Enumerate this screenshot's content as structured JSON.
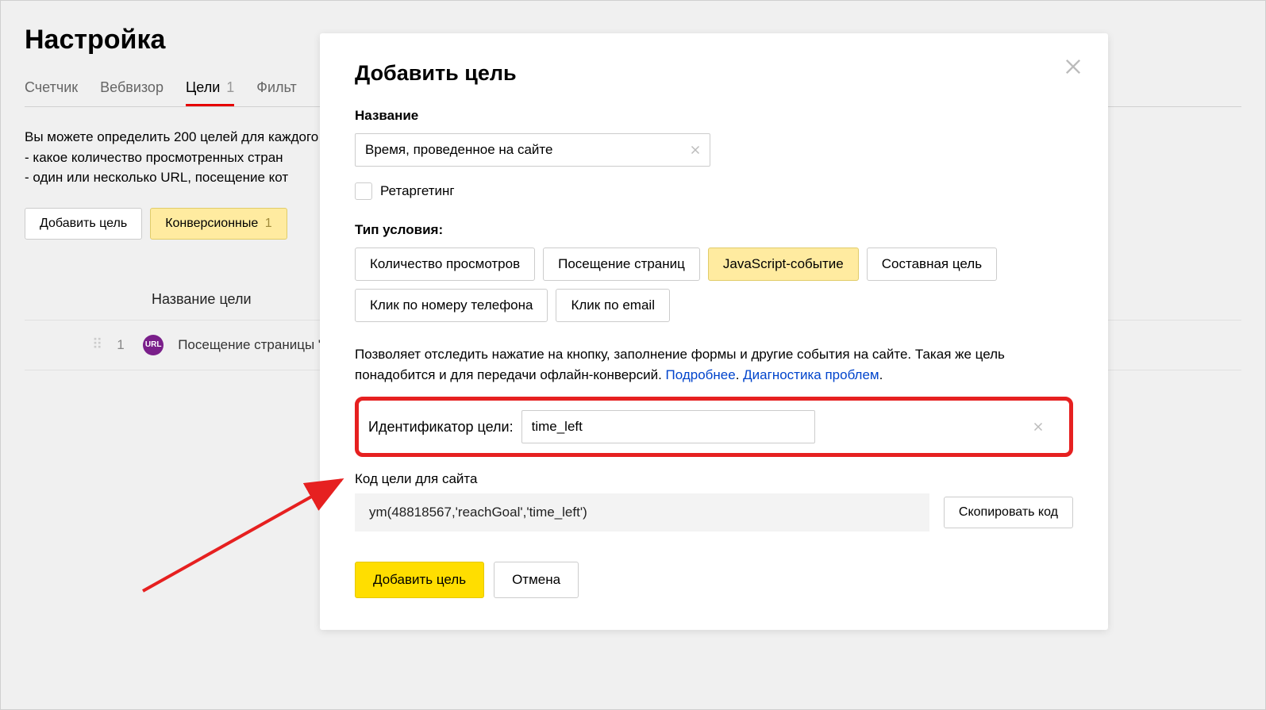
{
  "page": {
    "title": "Настройка",
    "description_line1": "Вы можете определить 200 целей для каждого",
    "description_line2": "- какое количество просмотренных стран",
    "description_line3": "- один или несколько URL, посещение кот"
  },
  "tabs": {
    "counter": "Счетчик",
    "webvisor": "Вебвизор",
    "goals": "Цели",
    "goals_count": "1",
    "filters": "Фильт"
  },
  "toolbar": {
    "add_goal": "Добавить цель",
    "conversion": "Конверсионные",
    "conversion_count": "1"
  },
  "table": {
    "header_name": "Название цели",
    "row1_index": "1",
    "row1_name": "Посещение страницы \"С",
    "row1_badge": "URL"
  },
  "modal": {
    "title": "Добавить цель",
    "name_label": "Название",
    "name_value": "Время, проведенное на сайте",
    "retargeting_label": "Ретаргетинг",
    "condition_label": "Тип условия:",
    "cond_views": "Количество просмотров",
    "cond_pages": "Посещение страниц",
    "cond_js": "JavaScript-событие",
    "cond_composite": "Составная цель",
    "cond_phone": "Клик по номеру телефона",
    "cond_email": "Клик по email",
    "help_text_1": "Позволяет отследить нажатие на кнопку, заполнение формы и другие события на сайте. Такая же цель понадобится и для передачи офлайн-конверсий. ",
    "help_link_1": "Подробнее",
    "help_sep": ". ",
    "help_link_2": "Диагностика проблем",
    "help_end": ".",
    "id_label": "Идентификатор цели:",
    "id_value": "time_left",
    "code_label": "Код цели для сайта",
    "code_value": "ym(48818567,'reachGoal','time_left')",
    "copy_button": "Скопировать код",
    "submit_button": "Добавить цель",
    "cancel_button": "Отмена"
  }
}
